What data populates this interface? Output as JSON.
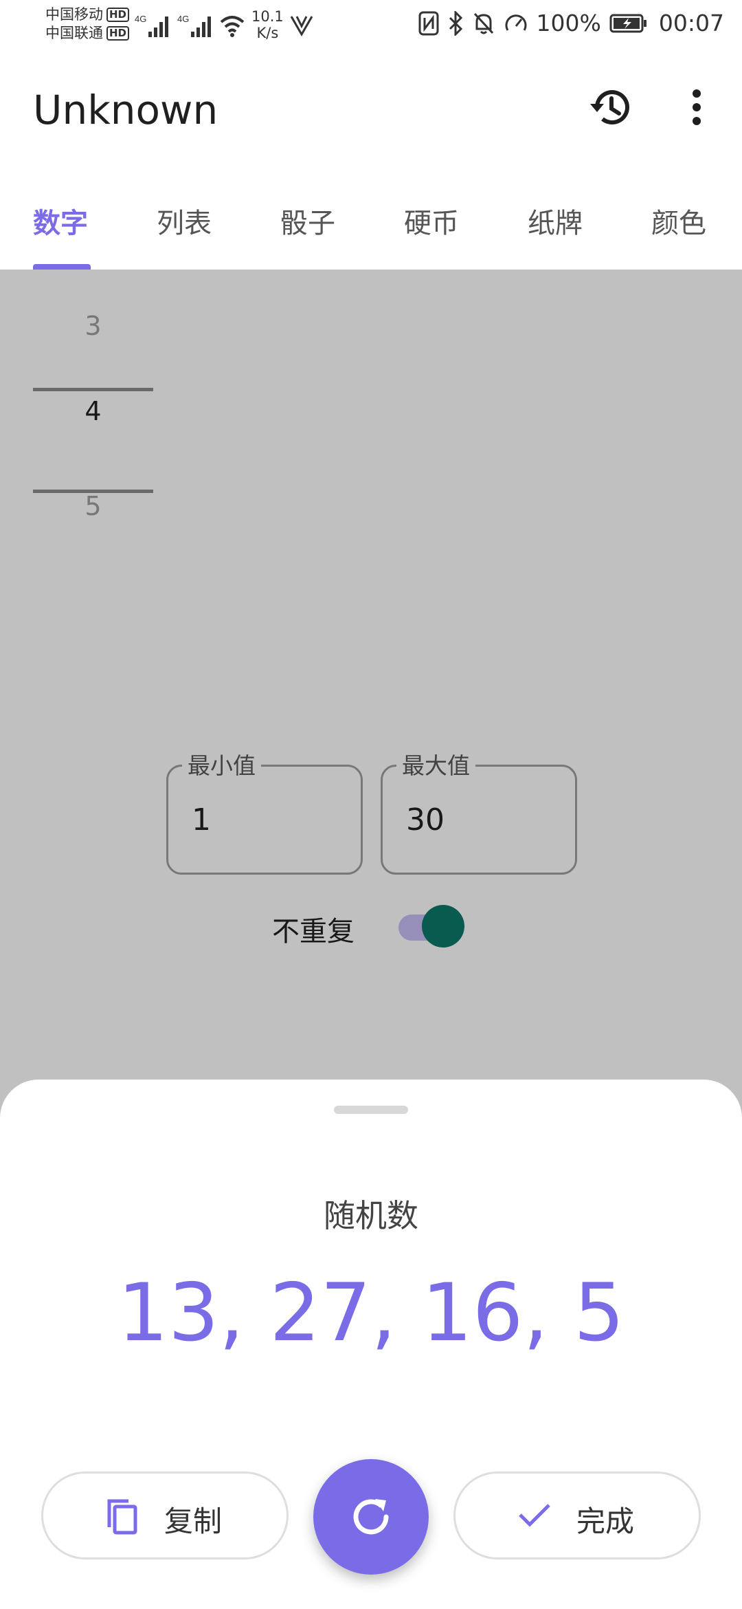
{
  "status_bar": {
    "carrier1": "中国移动",
    "carrier2": "中国联通",
    "hd": "HD",
    "net_label": "4G",
    "speed_value": "10.1",
    "speed_unit": "K/s",
    "battery": "100%",
    "time": "00:07"
  },
  "app_bar": {
    "title": "Unknown",
    "history_icon": "history-icon",
    "more_icon": "more-vert-icon"
  },
  "tabs": [
    {
      "label": "数字",
      "active": true
    },
    {
      "label": "列表",
      "active": false
    },
    {
      "label": "骰子",
      "active": false
    },
    {
      "label": "硬币",
      "active": false
    },
    {
      "label": "纸牌",
      "active": false
    },
    {
      "label": "颜色",
      "active": false
    }
  ],
  "picker": {
    "prev": "3",
    "current": "4",
    "next": "5"
  },
  "min_field": {
    "label": "最小值",
    "value": "1"
  },
  "max_field": {
    "label": "最大值",
    "value": "30"
  },
  "no_repeat": {
    "label": "不重复",
    "enabled": true
  },
  "sheet": {
    "title": "随机数",
    "result": "13, 27, 16, 5",
    "copy_label": "复制",
    "done_label": "完成"
  },
  "colors": {
    "accent": "#7a6be6",
    "toggle_thumb": "#0c7567"
  }
}
